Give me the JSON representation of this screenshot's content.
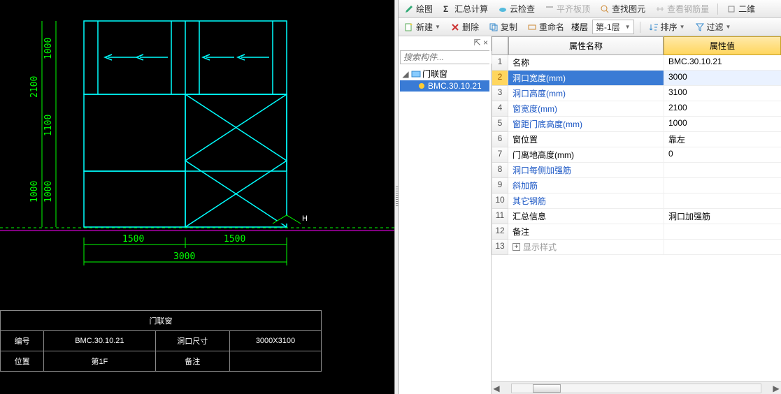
{
  "cad": {
    "dims": {
      "h1": "1000",
      "h2": "1100",
      "h3": "1000",
      "htotal": "2100",
      "htotal2": "1000",
      "w1": "1500",
      "w2": "1500",
      "wtotal": "3000"
    },
    "marker": "H",
    "title": "门联窗",
    "info": {
      "h1": "编号",
      "v1": "BMC.30.10.21",
      "h2": "洞口尺寸",
      "v2": "3000X3100",
      "h3": "位置",
      "v3": "第1F",
      "h4": "备注",
      "v4": ""
    }
  },
  "toolbar1": {
    "draw": "绘图",
    "sum": "汇总计算",
    "cloud": "云检查",
    "align": "平齐板顶",
    "find": "查找图元",
    "rebar": "查看钢筋量",
    "threeD": "二维"
  },
  "toolbar2": {
    "new": "新建",
    "del": "删除",
    "copy": "复制",
    "rename": "重命名",
    "floor_lbl": "楼层",
    "floor_val": "第-1层",
    "sort": "排序",
    "filter": "过滤"
  },
  "tree": {
    "search_ph": "搜索构件...",
    "root": "门联窗",
    "item": "BMC.30.10.21"
  },
  "prop": {
    "head_name": "属性名称",
    "head_val": "属性值",
    "rows": [
      {
        "n": "1",
        "name": "名称",
        "val": "BMC.30.10.21",
        "cls": ""
      },
      {
        "n": "2",
        "name": "洞口宽度(mm)",
        "val": "3000",
        "cls": "blue",
        "sel": true
      },
      {
        "n": "3",
        "name": "洞口高度(mm)",
        "val": "3100",
        "cls": "blue"
      },
      {
        "n": "4",
        "name": "窗宽度(mm)",
        "val": "2100",
        "cls": "blue"
      },
      {
        "n": "5",
        "name": "窗距门底高度(mm)",
        "val": "1000",
        "cls": "blue"
      },
      {
        "n": "6",
        "name": "窗位置",
        "val": "靠左",
        "cls": ""
      },
      {
        "n": "7",
        "name": "门离地高度(mm)",
        "val": "0",
        "cls": ""
      },
      {
        "n": "8",
        "name": "洞口每侧加强筋",
        "val": "",
        "cls": "blue"
      },
      {
        "n": "9",
        "name": "斜加筋",
        "val": "",
        "cls": "blue"
      },
      {
        "n": "10",
        "name": "其它钢筋",
        "val": "",
        "cls": "blue"
      },
      {
        "n": "11",
        "name": "汇总信息",
        "val": "洞口加强筋",
        "cls": ""
      },
      {
        "n": "12",
        "name": "备注",
        "val": "",
        "cls": ""
      },
      {
        "n": "13",
        "name": "显示样式",
        "val": "",
        "cls": "gray",
        "plus": true
      }
    ]
  },
  "pin_glyphs": {
    "pin": "⇱",
    "close": "×"
  }
}
